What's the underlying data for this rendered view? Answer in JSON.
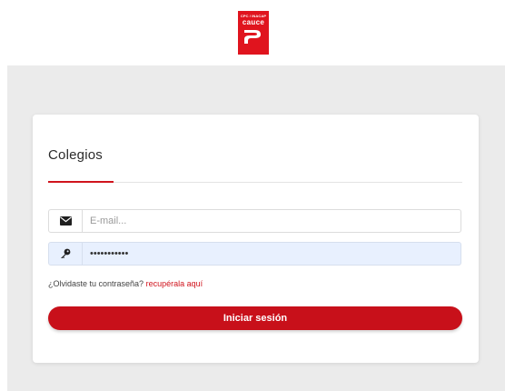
{
  "logo": {
    "top_text": "CPC / INACAP",
    "word": "cauce"
  },
  "card": {
    "title": "Colegios"
  },
  "login": {
    "email_placeholder": "E-mail...",
    "password_value": "***********",
    "forgot_text": "¿Olvidaste tu contraseña?",
    "forgot_link": "recupérala aquí",
    "submit_label": "Iniciar sesión"
  },
  "icons": {
    "email": "envelope-icon",
    "password": "key-icon"
  },
  "colors": {
    "brand_red": "#c8101a",
    "page_bg": "#ebebeb",
    "autofill_bg": "#e8f0fe"
  }
}
